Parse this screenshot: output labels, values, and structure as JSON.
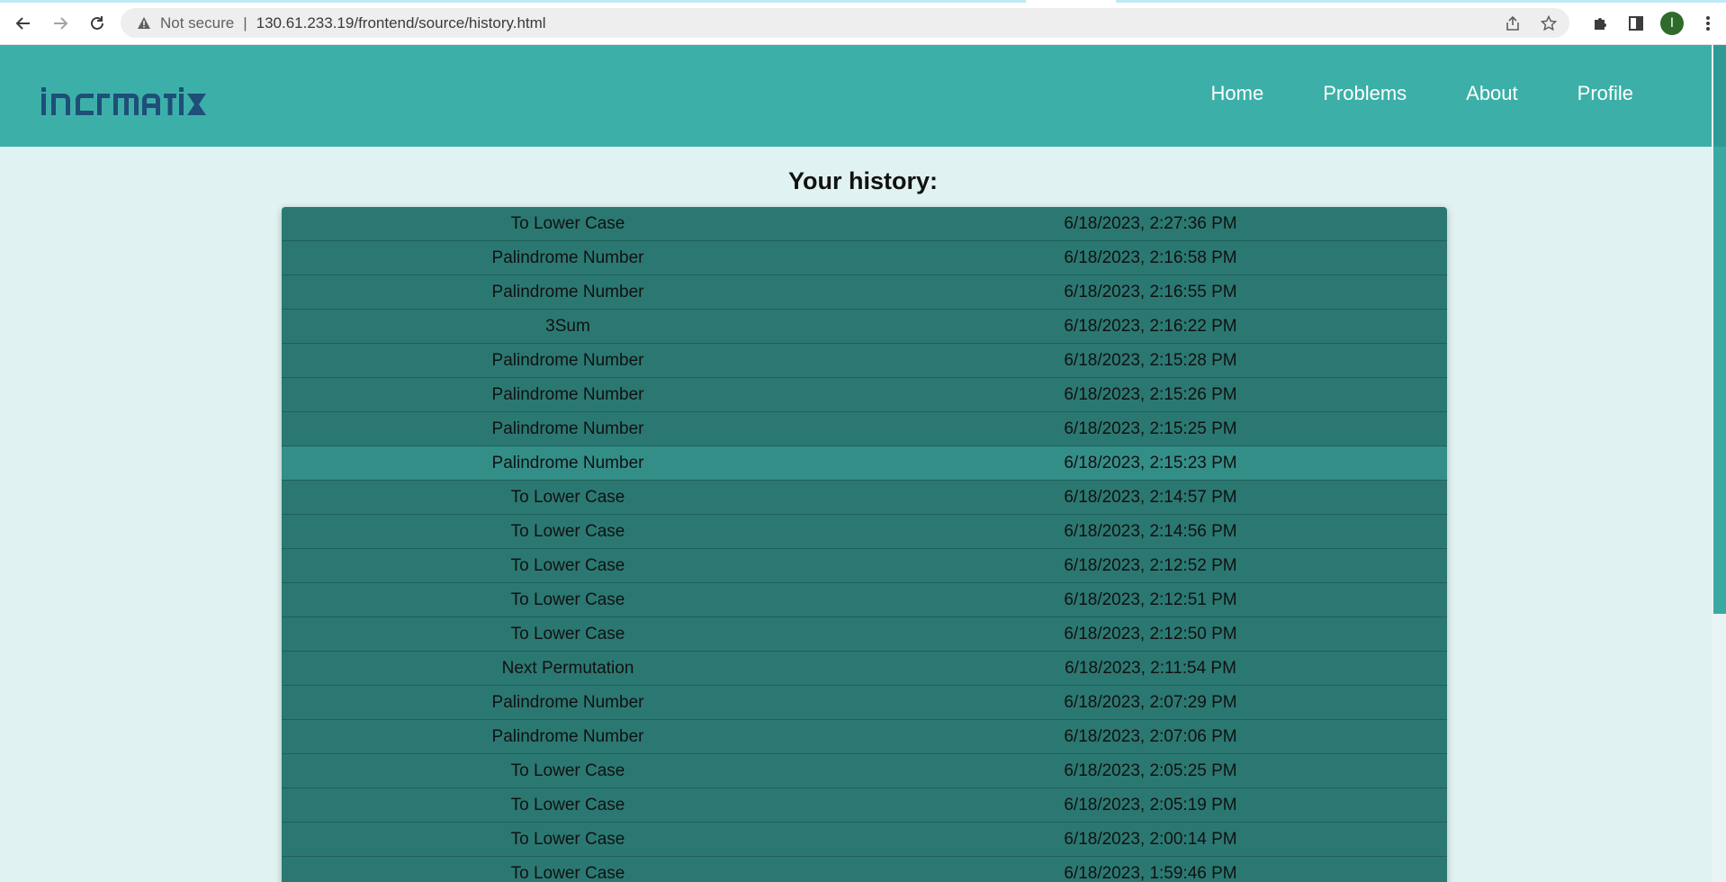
{
  "browser": {
    "security_label": "Not secure",
    "separator": "|",
    "url": "130.61.233.19/frontend/source/history.html",
    "profile_initial": "I"
  },
  "site": {
    "logo_text": "informatix",
    "nav": [
      {
        "label": "Home"
      },
      {
        "label": "Problems"
      },
      {
        "label": "About"
      },
      {
        "label": "Profile"
      }
    ]
  },
  "page": {
    "title": "Your history:"
  },
  "history": [
    {
      "problem": "To Lower Case",
      "date": "6/18/2023, 2:27:36 PM"
    },
    {
      "problem": "Palindrome Number",
      "date": "6/18/2023, 2:16:58 PM"
    },
    {
      "problem": "Palindrome Number",
      "date": "6/18/2023, 2:16:55 PM"
    },
    {
      "problem": "3Sum",
      "date": "6/18/2023, 2:16:22 PM"
    },
    {
      "problem": "Palindrome Number",
      "date": "6/18/2023, 2:15:28 PM"
    },
    {
      "problem": "Palindrome Number",
      "date": "6/18/2023, 2:15:26 PM"
    },
    {
      "problem": "Palindrome Number",
      "date": "6/18/2023, 2:15:25 PM"
    },
    {
      "problem": "Palindrome Number",
      "date": "6/18/2023, 2:15:23 PM"
    },
    {
      "problem": "To Lower Case",
      "date": "6/18/2023, 2:14:57 PM"
    },
    {
      "problem": "To Lower Case",
      "date": "6/18/2023, 2:14:56 PM"
    },
    {
      "problem": "To Lower Case",
      "date": "6/18/2023, 2:12:52 PM"
    },
    {
      "problem": "To Lower Case",
      "date": "6/18/2023, 2:12:51 PM"
    },
    {
      "problem": "To Lower Case",
      "date": "6/18/2023, 2:12:50 PM"
    },
    {
      "problem": "Next Permutation",
      "date": "6/18/2023, 2:11:54 PM"
    },
    {
      "problem": "Palindrome Number",
      "date": "6/18/2023, 2:07:29 PM"
    },
    {
      "problem": "Palindrome Number",
      "date": "6/18/2023, 2:07:06 PM"
    },
    {
      "problem": "To Lower Case",
      "date": "6/18/2023, 2:05:25 PM"
    },
    {
      "problem": "To Lower Case",
      "date": "6/18/2023, 2:05:19 PM"
    },
    {
      "problem": "To Lower Case",
      "date": "6/18/2023, 2:00:14 PM"
    },
    {
      "problem": "To Lower Case",
      "date": "6/18/2023, 1:59:46 PM"
    }
  ],
  "colors": {
    "header_bg": "#3cb0a8",
    "page_bg": "#e0f2f1",
    "row_bg": "#2b7872",
    "row_hover_bg": "#348e88",
    "logo": "#1f4e79"
  },
  "icons": [
    "back-arrow-icon",
    "forward-arrow-icon",
    "reload-icon",
    "warning-icon",
    "share-icon",
    "star-icon",
    "puzzle-icon",
    "sidebar-icon",
    "kebab-menu-icon"
  ]
}
